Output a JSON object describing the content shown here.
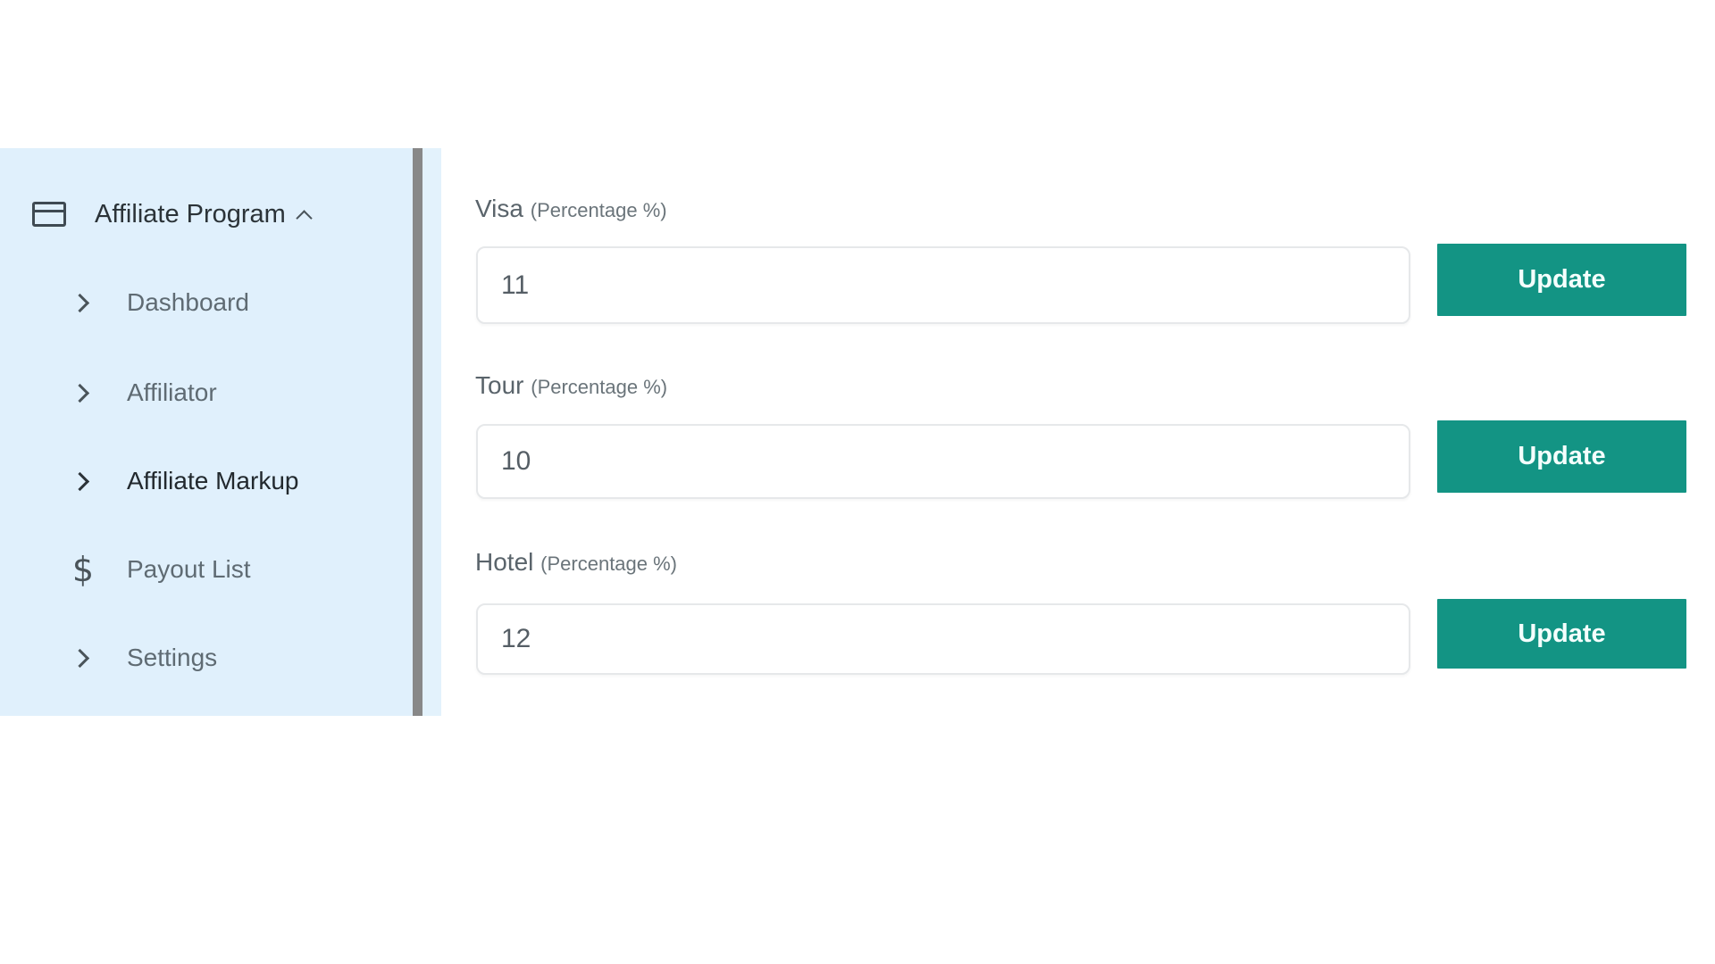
{
  "sidebar": {
    "group": {
      "title": "Affiliate Program",
      "icon": "credit-card-icon",
      "expanded": true
    },
    "items": [
      {
        "label": "Dashboard",
        "icon": "chevron-right-icon",
        "active": false
      },
      {
        "label": "Affiliator",
        "icon": "chevron-right-icon",
        "active": false
      },
      {
        "label": "Affiliate Markup",
        "icon": "chevron-right-icon",
        "active": true
      },
      {
        "label": "Payout List",
        "icon": "dollar-icon",
        "active": false
      },
      {
        "label": "Settings",
        "icon": "chevron-right-icon",
        "active": false
      }
    ]
  },
  "form": {
    "fields": [
      {
        "label": "Visa",
        "hint": "(Percentage %)",
        "value": "11",
        "button": "Update"
      },
      {
        "label": "Tour",
        "hint": "(Percentage %)",
        "value": "10",
        "button": "Update"
      },
      {
        "label": "Hotel",
        "hint": "(Percentage %)",
        "value": "12",
        "button": "Update"
      }
    ]
  },
  "colors": {
    "accent": "#139484",
    "sidebar_bg": "#e0f0fc"
  }
}
